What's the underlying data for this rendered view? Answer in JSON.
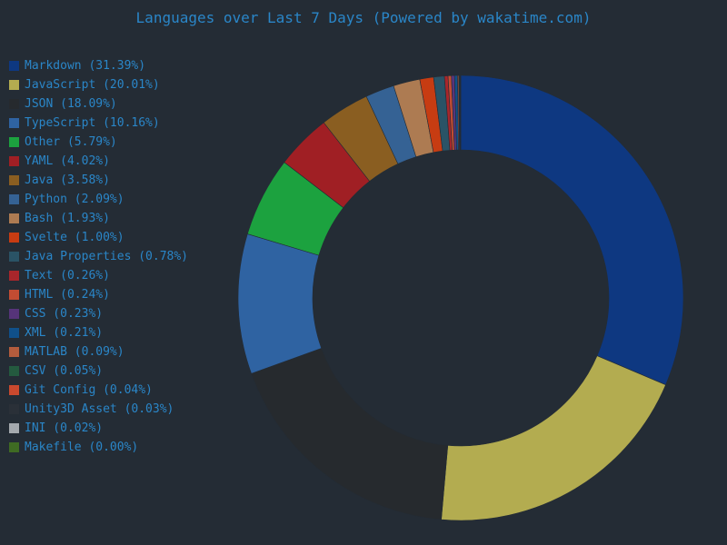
{
  "chart_data": {
    "type": "pie",
    "style": "donut",
    "title": "Languages over Last 7 Days (Powered by wakatime.com)",
    "legend_position": "left",
    "series": [
      {
        "label": "Markdown (31.39%)",
        "value": 31.39,
        "color": "#0e3881"
      },
      {
        "label": "JavaScript (20.01%)",
        "value": 20.01,
        "color": "#b3ac50"
      },
      {
        "label": "JSON (18.09%)",
        "value": 18.09,
        "color": "#262a2e"
      },
      {
        "label": "TypeScript (10.16%)",
        "value": 10.16,
        "color": "#2f63a2"
      },
      {
        "label": "Other (5.79%)",
        "value": 5.79,
        "color": "#1ca23f"
      },
      {
        "label": "YAML (4.02%)",
        "value": 4.02,
        "color": "#a01f24"
      },
      {
        "label": "Java (3.58%)",
        "value": 3.58,
        "color": "#8a5e21"
      },
      {
        "label": "Python (2.09%)",
        "value": 2.09,
        "color": "#356294"
      },
      {
        "label": "Bash (1.93%)",
        "value": 1.93,
        "color": "#ad7b52"
      },
      {
        "label": "Svelte (1.00%)",
        "value": 1.0,
        "color": "#c73c12"
      },
      {
        "label": "Java Properties (0.78%)",
        "value": 0.78,
        "color": "#2a5366"
      },
      {
        "label": "Text (0.26%)",
        "value": 0.26,
        "color": "#a8262b"
      },
      {
        "label": "HTML (0.24%)",
        "value": 0.24,
        "color": "#c24c33"
      },
      {
        "label": "CSS (0.23%)",
        "value": 0.23,
        "color": "#56347a"
      },
      {
        "label": "XML (0.21%)",
        "value": 0.21,
        "color": "#10508a"
      },
      {
        "label": "MATLAB (0.09%)",
        "value": 0.09,
        "color": "#b35c3d"
      },
      {
        "label": "CSV (0.05%)",
        "value": 0.05,
        "color": "#245a3f"
      },
      {
        "label": "Git Config (0.04%)",
        "value": 0.04,
        "color": "#c9492e"
      },
      {
        "label": "Unity3D Asset (0.03%)",
        "value": 0.03,
        "color": "#2a3038"
      },
      {
        "label": "INI (0.02%)",
        "value": 0.02,
        "color": "#a4a9ae"
      },
      {
        "label": "Makefile (0.00%)",
        "value": 0.0,
        "color": "#3f6b23"
      }
    ]
  }
}
